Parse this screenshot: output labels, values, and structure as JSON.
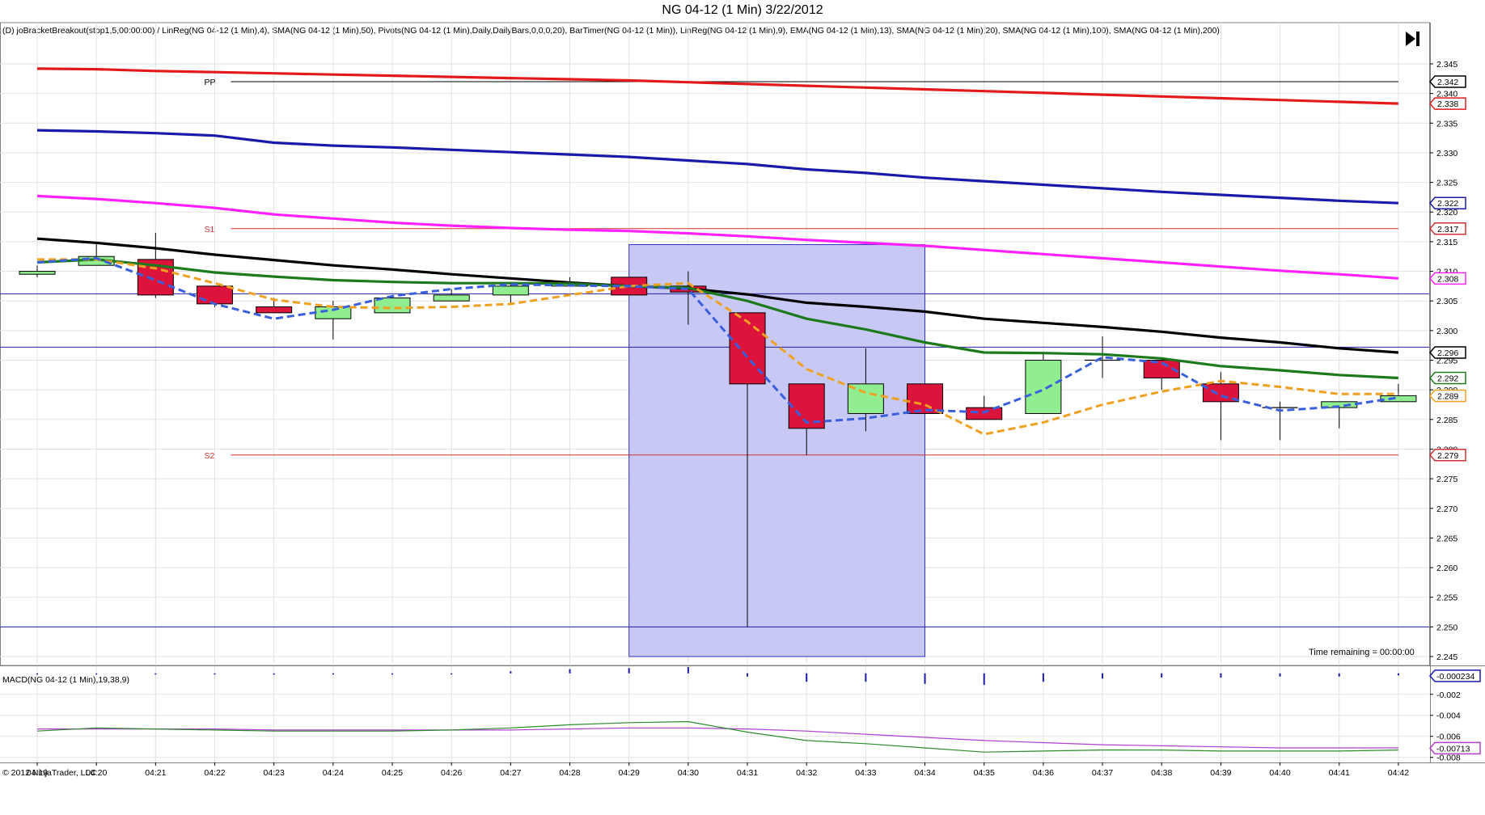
{
  "window": {
    "title": "NG 04-12 (1 Min)  3/22/2012",
    "indicator_header": "(D) joBracketBreakout(stop1,5,00:00:00) / LinReg(NG 04-12 (1 Min),4), SMA(NG 04-12 (1 Min),50), Pivots(NG 04-12 (1 Min),Daily,DailyBars,0,0,0,20), BarTimer(NG 04-12 (1 Min)), LinReg(NG 04-12 (1 Min),9), EMA(NG 04-12 (1 Min),13), SMA(NG 04-12 (1 Min),20), SMA(NG 04-12 (1 Min),100), SMA(NG 04-12 (1 Min),200)",
    "macd_header": "MACD(NG 04-12 (1 Min),19,38,9)",
    "copyright": "© 2012 NinjaTrader, LLC",
    "time_remaining": "Time remaining = 00:00:00",
    "jump_icon": "skip-to-end-icon"
  },
  "colors": {
    "up_candle": "#90ee90",
    "down_candle": "#dc143c",
    "sma200": "#e31a1c",
    "sma100": "#1a1aaa",
    "sma50": "#ff22ff",
    "sma20": "#000000",
    "ema13": "#1c7a1c",
    "linreg9": "#f0a020",
    "linreg4": "#3a5fdc",
    "pivot_pp": "#000000",
    "pivot_s": "#d03030",
    "bracket_fill": "#c8c8f5",
    "bracket_border": "#3030c0",
    "bracket_lines": "#2020a0",
    "macd_line": "#2e8b2e",
    "macd_avg": "#b040d0",
    "macd_hist": "#1a1aaa"
  },
  "chart_data": {
    "type": "candlestick",
    "x_labels": [
      "04:19",
      "04:20",
      "04:21",
      "04:22",
      "04:23",
      "04:24",
      "04:25",
      "04:26",
      "04:27",
      "04:28",
      "04:29",
      "04:30",
      "04:31",
      "04:32",
      "04:33",
      "04:34",
      "04:35",
      "04:36",
      "04:37",
      "04:38",
      "04:39",
      "04:40",
      "04:41",
      "04:42"
    ],
    "ylim": [
      2.2435,
      2.3495
    ],
    "y_ticks": [
      "2.345",
      "2.340",
      "2.335",
      "2.330",
      "2.325",
      "2.320",
      "2.315",
      "2.310",
      "2.305",
      "2.300",
      "2.295",
      "2.290",
      "2.285",
      "2.280",
      "2.275",
      "2.270",
      "2.265",
      "2.260",
      "2.255",
      "2.250",
      "2.245"
    ],
    "ohlc": [
      [
        2.3095,
        2.311,
        2.309,
        2.31
      ],
      [
        2.311,
        2.315,
        2.311,
        2.3125
      ],
      [
        2.312,
        2.3165,
        2.3055,
        2.306
      ],
      [
        2.3075,
        2.3075,
        2.304,
        2.3045
      ],
      [
        2.304,
        2.3055,
        2.303,
        2.303
      ],
      [
        2.302,
        2.305,
        2.2985,
        2.304
      ],
      [
        2.303,
        2.306,
        2.303,
        2.3055
      ],
      [
        2.305,
        2.307,
        2.305,
        2.306
      ],
      [
        2.306,
        2.308,
        2.3045,
        2.3075
      ],
      [
        2.3075,
        2.309,
        2.3075,
        2.308
      ],
      [
        2.309,
        2.309,
        2.306,
        2.306
      ],
      [
        2.3075,
        2.31,
        2.301,
        2.3065
      ],
      [
        2.303,
        2.303,
        2.25,
        2.291
      ],
      [
        2.291,
        2.291,
        2.279,
        2.2835
      ],
      [
        2.286,
        2.297,
        2.283,
        2.291
      ],
      [
        2.291,
        2.291,
        2.286,
        2.286
      ],
      [
        2.287,
        2.289,
        2.285,
        2.285
      ],
      [
        2.286,
        2.296,
        2.286,
        2.295
      ],
      [
        2.295,
        2.299,
        2.292,
        2.295
      ],
      [
        2.295,
        2.295,
        2.29,
        2.292
      ],
      [
        2.291,
        2.293,
        2.2815,
        2.288
      ],
      [
        2.287,
        2.288,
        2.2815,
        2.287
      ],
      [
        2.287,
        2.288,
        2.2835,
        2.288
      ],
      [
        2.288,
        2.291,
        2.288,
        2.289
      ]
    ],
    "series": [
      {
        "key": "sma200",
        "values": [
          2.3442,
          2.3441,
          2.3438,
          2.3436,
          2.3434,
          2.3432,
          2.343,
          2.3428,
          2.3426,
          2.3424,
          2.3422,
          2.3419,
          2.3416,
          2.3413,
          2.341,
          2.3407,
          2.3404,
          2.3401,
          2.3398,
          2.3395,
          2.3392,
          2.3389,
          2.3386,
          2.3383
        ]
      },
      {
        "key": "sma100",
        "values": [
          2.3338,
          2.3336,
          2.3333,
          2.3329,
          2.3317,
          2.3312,
          2.3309,
          2.3305,
          2.3301,
          2.3297,
          2.3293,
          2.3287,
          2.3281,
          2.3272,
          2.3266,
          2.3258,
          2.3252,
          2.3246,
          2.324,
          2.3234,
          2.3229,
          2.3224,
          2.3219,
          2.3215
        ]
      },
      {
        "key": "sma50",
        "values": [
          2.3227,
          2.3222,
          2.3215,
          2.3207,
          2.3196,
          2.3189,
          2.3182,
          2.3177,
          2.3173,
          2.317,
          2.3168,
          2.3164,
          2.3159,
          2.3153,
          2.3148,
          2.3143,
          2.3136,
          2.3129,
          2.3122,
          2.3115,
          2.3108,
          2.3101,
          2.3095,
          2.3088
        ]
      },
      {
        "key": "sma20",
        "values": [
          2.3155,
          2.3148,
          2.3139,
          2.3128,
          2.3119,
          2.311,
          2.3103,
          2.3095,
          2.3088,
          2.3081,
          2.3075,
          2.3071,
          2.3061,
          2.3047,
          2.304,
          2.3032,
          2.302,
          2.3013,
          2.3006,
          2.2998,
          2.2988,
          2.298,
          2.297,
          2.2963
        ]
      },
      {
        "key": "ema13",
        "values": [
          2.3115,
          2.312,
          2.311,
          2.3098,
          2.3091,
          2.3085,
          2.3082,
          2.308,
          2.308,
          2.3079,
          2.3075,
          2.3072,
          2.305,
          2.302,
          2.3002,
          2.298,
          2.2963,
          2.2962,
          2.296,
          2.2953,
          2.294,
          2.2933,
          2.2925,
          2.292
        ]
      },
      {
        "key": "linreg9",
        "values": [
          2.312,
          2.312,
          2.3105,
          2.308,
          2.3052,
          2.304,
          2.3038,
          2.304,
          2.3045,
          2.306,
          2.3075,
          2.308,
          2.3015,
          2.2935,
          2.2895,
          2.2875,
          2.2825,
          2.2845,
          2.2875,
          2.2897,
          2.2915,
          2.2905,
          2.2893,
          2.2893
        ]
      },
      {
        "key": "linreg4",
        "values": [
          2.3115,
          2.3122,
          2.3085,
          2.3045,
          2.302,
          2.3035,
          2.3058,
          2.307,
          2.3078,
          2.3076,
          2.3075,
          2.307,
          2.2955,
          2.2845,
          2.2852,
          2.2866,
          2.2862,
          2.29,
          2.2955,
          2.2946,
          2.289,
          2.2865,
          2.2872,
          2.2887
        ]
      }
    ],
    "pivots": [
      {
        "label": "PP",
        "value": 2.342,
        "x_start": "04:22"
      },
      {
        "label": "S1",
        "value": 2.3172,
        "x_start": "04:22"
      },
      {
        "label": "S2",
        "value": 2.279,
        "x_start": "04:22"
      }
    ],
    "bracket": {
      "x_start": "04:29",
      "x_end": "04:34",
      "high": 2.3145,
      "low": 2.245
    },
    "bracket_lines": [
      2.3062,
      2.2972,
      2.25
    ],
    "price_markers": [
      {
        "label": "2.342",
        "value": 2.342,
        "color_key": "pivot_pp"
      },
      {
        "label": "2.338",
        "value": 2.3383,
        "color_key": "sma200"
      },
      {
        "label": "2.322",
        "value": 2.3215,
        "color_key": "sma100"
      },
      {
        "label": "2.317",
        "value": 2.3172,
        "color_key": "pivot_s"
      },
      {
        "label": "2.308",
        "value": 2.3088,
        "color_key": "sma50"
      },
      {
        "label": "2.296",
        "value": 2.2963,
        "color_key": "sma20"
      },
      {
        "label": "2.292",
        "value": 2.292,
        "color_key": "ema13"
      },
      {
        "label": "2.289",
        "value": 2.289,
        "color_key": "linreg9"
      },
      {
        "label": "2.279",
        "value": 2.279,
        "color_key": "pivot_s"
      }
    ],
    "macd": {
      "ylim": [
        -0.0081,
        0.0006
      ],
      "y_ticks": [
        "-0.002",
        "-0.004",
        "-0.006",
        "-0.008"
      ],
      "macd_line": [
        -0.0055,
        -0.0052,
        -0.0053,
        -0.0054,
        -0.0055,
        -0.0055,
        -0.0055,
        -0.0054,
        -0.0052,
        -0.0049,
        -0.0047,
        -0.0046,
        -0.0056,
        -0.0064,
        -0.0067,
        -0.0071,
        -0.0075,
        -0.0074,
        -0.0073,
        -0.0073,
        -0.0074,
        -0.0074,
        -0.0074,
        -0.0073
      ],
      "avg_line": [
        -0.0053,
        -0.0053,
        -0.0053,
        -0.0053,
        -0.0054,
        -0.0054,
        -0.0054,
        -0.0054,
        -0.0054,
        -0.0053,
        -0.0052,
        -0.0052,
        -0.0053,
        -0.0055,
        -0.0058,
        -0.0061,
        -0.0064,
        -0.0066,
        -0.0068,
        -0.0069,
        -0.007,
        -0.0071,
        -0.0071,
        -0.0071
      ],
      "histogram": [
        -0.0001,
        0.0,
        -0.0001,
        -0.0001,
        -0.0001,
        -0.0001,
        0.0,
        0.0,
        0.0002,
        0.0004,
        0.0005,
        0.0006,
        -0.0003,
        -0.0008,
        -0.0008,
        -0.001,
        -0.0011,
        -0.0008,
        -0.0005,
        -0.0004,
        -0.0004,
        -0.0003,
        -0.0003,
        -0.0002
      ],
      "markers": [
        {
          "label": "-0.000234",
          "value": -0.000234,
          "color_key": "macd_hist"
        },
        {
          "label": "-0.00713",
          "value": -0.00713,
          "color_key": "macd_avg"
        }
      ]
    }
  }
}
